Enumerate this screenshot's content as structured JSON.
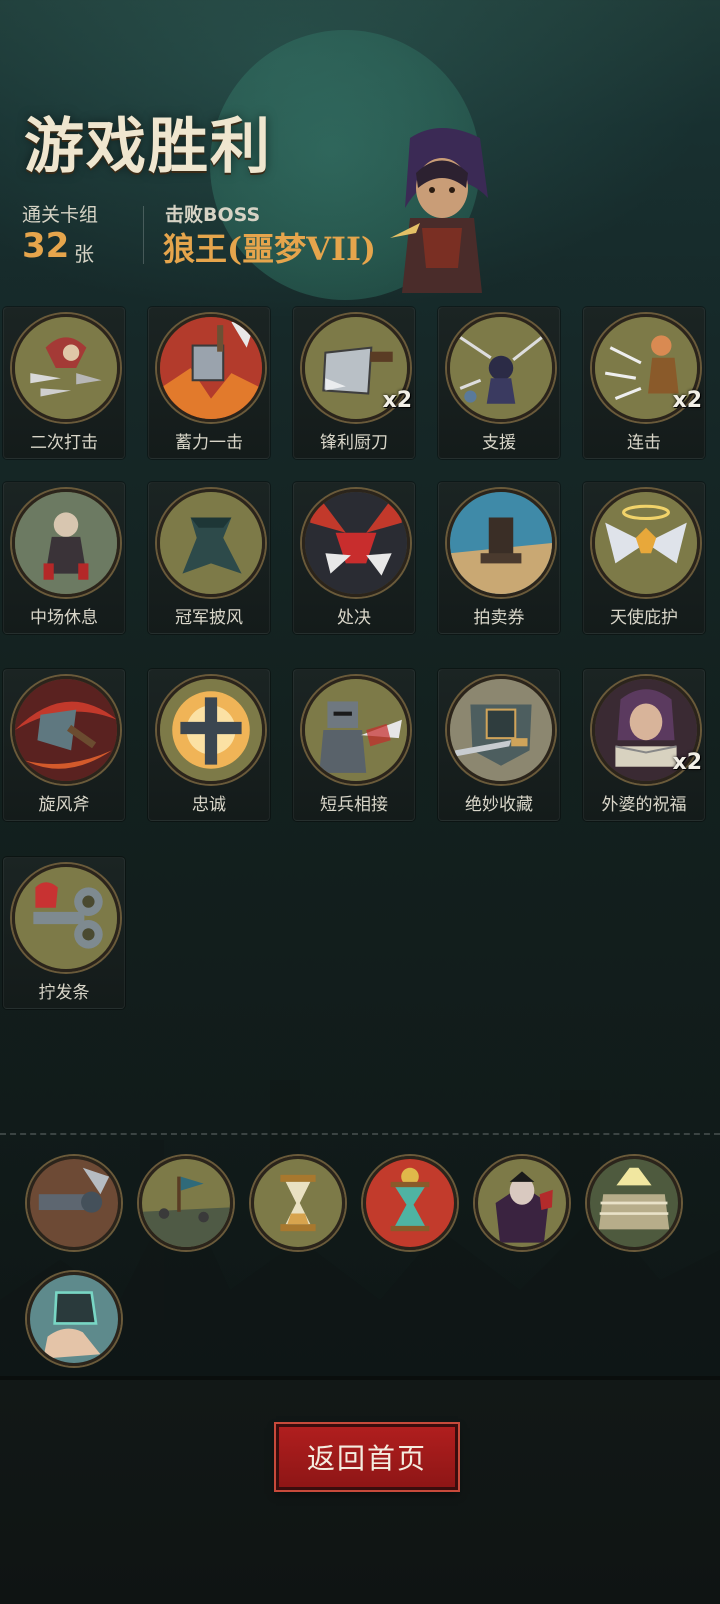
{
  "header": {
    "title": "游戏胜利",
    "deck_label": "通关卡组",
    "deck_count": "32",
    "deck_unit": "张",
    "boss_label": "击败BOSS",
    "boss_name": "狼王(噩梦VII)"
  },
  "cards": [
    {
      "label": "二次打击",
      "badge": "",
      "icon": "double-strike-icon"
    },
    {
      "label": "蓄力一击",
      "badge": "",
      "icon": "charged-strike-icon"
    },
    {
      "label": "锋利厨刀",
      "badge": "x2",
      "icon": "cleaver-icon"
    },
    {
      "label": "支援",
      "badge": "",
      "icon": "support-icon"
    },
    {
      "label": "连击",
      "badge": "x2",
      "icon": "combo-icon"
    },
    {
      "label": "中场休息",
      "badge": "",
      "icon": "intermission-icon"
    },
    {
      "label": "冠军披风",
      "badge": "",
      "icon": "cape-icon"
    },
    {
      "label": "处决",
      "badge": "",
      "icon": "execute-icon"
    },
    {
      "label": "拍卖券",
      "badge": "",
      "icon": "auction-icon"
    },
    {
      "label": "天使庇护",
      "badge": "",
      "icon": "angel-icon"
    },
    {
      "label": "旋风斧",
      "badge": "",
      "icon": "whirlwind-axe-icon"
    },
    {
      "label": "忠诚",
      "badge": "",
      "icon": "loyalty-icon"
    },
    {
      "label": "短兵相接",
      "badge": "",
      "icon": "melee-icon"
    },
    {
      "label": "绝妙收藏",
      "badge": "",
      "icon": "collection-icon"
    },
    {
      "label": "外婆的祝福",
      "badge": "x2",
      "icon": "grandma-icon"
    },
    {
      "label": "拧发条",
      "badge": "",
      "icon": "wind-up-key-icon"
    }
  ],
  "relics": [
    {
      "icon": "cannon-relic-icon"
    },
    {
      "icon": "battlefield-relic-icon"
    },
    {
      "icon": "hourglass-relic-icon"
    },
    {
      "icon": "red-hourglass-relic-icon"
    },
    {
      "icon": "vampire-relic-icon"
    },
    {
      "icon": "boxing-ring-relic-icon"
    },
    {
      "icon": "magic-hand-relic-icon"
    }
  ],
  "footer": {
    "home_button": "返回首页"
  },
  "colors": {
    "accent_gold": "#e6a54c",
    "button_red": "#b01e1e",
    "medal_olive": "#7d7a48"
  }
}
